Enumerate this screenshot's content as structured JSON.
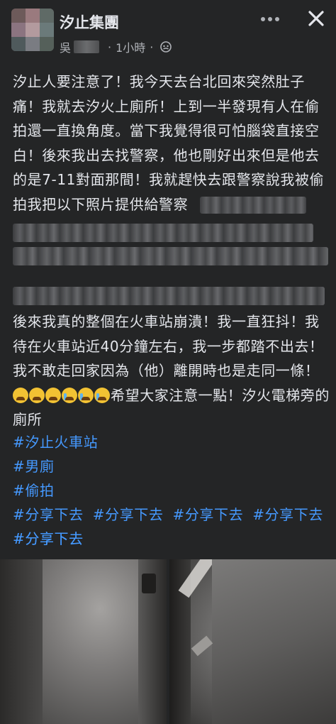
{
  "header": {
    "group_name": "汐止集團",
    "author_initial": "吳",
    "time": "1小時",
    "dot": "·"
  },
  "post": {
    "paragraph1": "汐止人要注意了！我今天去台北回來突然肚子痛！我就去汐火上廁所！上到一半發現有人在偷拍還一直換角度。當下我覺得很可怕腦袋直接空白！後來我出去找警察，他也剛好出來但是他去的是7-11對面那間！我就趕快去跟警察說我被偷拍我把以下照片提供給警察",
    "paragraph2_a": "後來我真的整個在火車站崩潰！我一直狂抖！我待在火車站近40分鐘左右，我一步都踏不出去！我不敢走回家因為（他）離開時也是走同一條！",
    "paragraph2_b": "希望大家注意一點！汐火電梯旁的廁所"
  },
  "hashtags": [
    "#汐止火車站",
    "#男廁",
    "#偷拍"
  ],
  "share_tags": [
    "#分享下去",
    "#分享下去",
    "#分享下去",
    "#分享下去",
    "#分享下去",
    "#分享下去"
  ],
  "emojis": [
    "crying-face",
    "crying-face",
    "crying-face",
    "loudly-crying-face",
    "loudly-crying-face",
    "loudly-crying-face"
  ],
  "colors": {
    "background": "#242526",
    "text": "#e4e6eb",
    "secondary": "#b0b3b8",
    "hashtag": "#4599ff"
  }
}
